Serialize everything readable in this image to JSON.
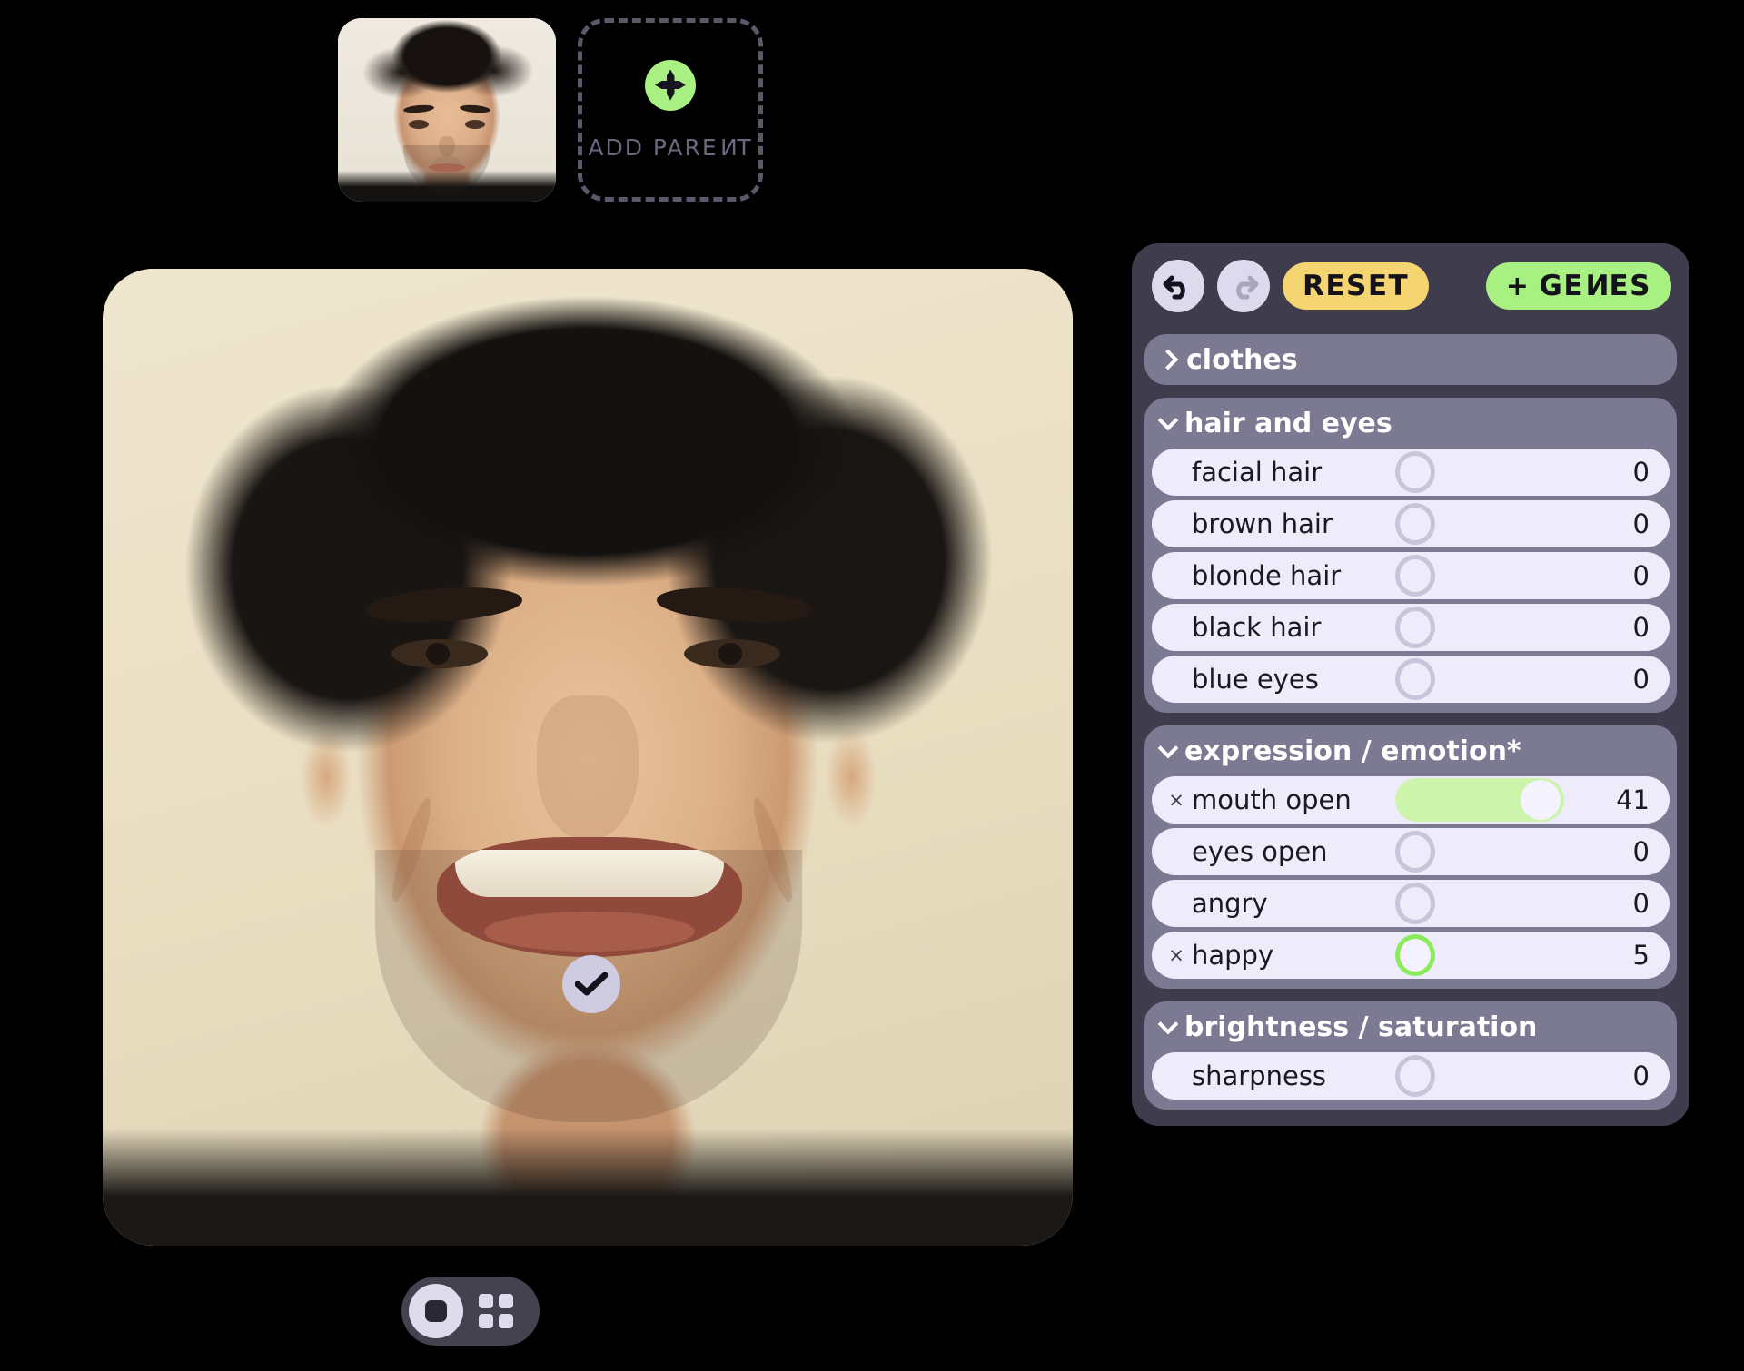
{
  "parents": {
    "thumbnail_alt": "parent-portrait",
    "add_parent_label": "ADD PARENT",
    "add_icon": "plus-icon"
  },
  "main_image": {
    "alt": "generated-portrait",
    "selected_badge_icon": "check-icon"
  },
  "view_toolbar": {
    "single_view_icon": "single-view-icon",
    "grid_view_icon": "grid-view-icon"
  },
  "panel": {
    "toolbar": {
      "undo_icon": "undo-icon",
      "redo_icon": "redo-icon",
      "reset_label": "RESET",
      "genes_plus": "+",
      "genes_label": "GENES"
    },
    "accent_green": "#a9f082",
    "accent_yellow": "#f5d472",
    "panel_bg": "#3f3c4e",
    "group_bg": "#7c7a92",
    "row_bg": "#eeecfa",
    "groups": [
      {
        "title": "clothes",
        "expanded": false,
        "chevron": "chevron-right-icon",
        "rows": []
      },
      {
        "title": "hair and eyes",
        "expanded": true,
        "chevron": "chevron-down-icon",
        "rows": [
          {
            "label": "facial hair",
            "value": "0",
            "active": false,
            "has_remove": false,
            "slider": "ring"
          },
          {
            "label": "brown hair",
            "value": "0",
            "active": false,
            "has_remove": false,
            "slider": "ring"
          },
          {
            "label": "blonde hair",
            "value": "0",
            "active": false,
            "has_remove": false,
            "slider": "ring"
          },
          {
            "label": "black hair",
            "value": "0",
            "active": false,
            "has_remove": false,
            "slider": "ring"
          },
          {
            "label": "blue eyes",
            "value": "0",
            "active": false,
            "has_remove": false,
            "slider": "ring"
          }
        ]
      },
      {
        "title": "expression / emotion*",
        "expanded": true,
        "chevron": "chevron-down-icon",
        "rows": [
          {
            "label": "mouth open",
            "value": "41",
            "active": true,
            "has_remove": true,
            "remove_label": "×",
            "slider": "track"
          },
          {
            "label": "eyes open",
            "value": "0",
            "active": false,
            "has_remove": false,
            "slider": "ring"
          },
          {
            "label": "angry",
            "value": "0",
            "active": false,
            "has_remove": false,
            "slider": "ring"
          },
          {
            "label": "happy",
            "value": "5",
            "active": true,
            "has_remove": true,
            "remove_label": "×",
            "slider": "ring-active"
          }
        ]
      },
      {
        "title": "brightness / saturation",
        "expanded": true,
        "chevron": "chevron-down-icon",
        "rows": [
          {
            "label": "sharpness",
            "value": "0",
            "active": false,
            "has_remove": false,
            "slider": "ring"
          }
        ]
      }
    ]
  }
}
